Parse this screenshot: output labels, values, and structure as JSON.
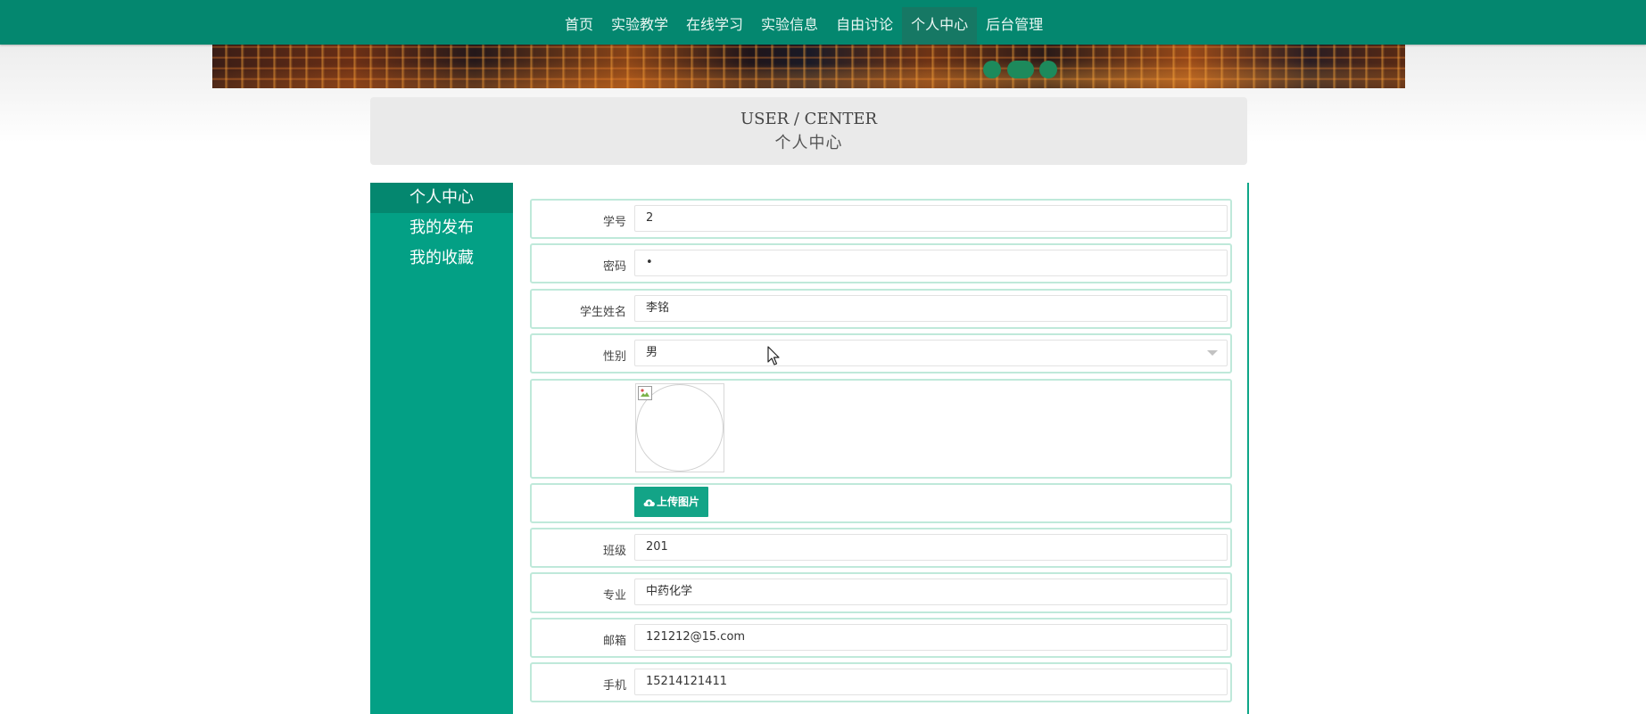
{
  "nav": {
    "items": [
      {
        "label": "首页",
        "active": false
      },
      {
        "label": "实验教学",
        "active": false
      },
      {
        "label": "在线学习",
        "active": false
      },
      {
        "label": "实验信息",
        "active": false
      },
      {
        "label": "自由讨论",
        "active": false
      },
      {
        "label": "个人中心",
        "active": true
      },
      {
        "label": "后台管理",
        "active": false
      }
    ]
  },
  "header": {
    "en_title": "USER / CENTER",
    "cn_title": "个人中心"
  },
  "sidebar": {
    "items": [
      {
        "label": "个人中心",
        "active": true
      },
      {
        "label": "我的发布",
        "active": false
      },
      {
        "label": "我的收藏",
        "active": false
      }
    ]
  },
  "form": {
    "student_id": {
      "label": "学号",
      "value": "2"
    },
    "password": {
      "label": "密码",
      "value": "•"
    },
    "student_name": {
      "label": "学生姓名",
      "value": "李铭"
    },
    "gender": {
      "label": "性别",
      "value": "男"
    },
    "upload_label": "上传图片",
    "class": {
      "label": "班级",
      "value": "201"
    },
    "major": {
      "label": "专业",
      "value": "中药化学"
    },
    "email": {
      "label": "邮箱",
      "value": "121212@15.com"
    },
    "phone": {
      "label": "手机",
      "value": "15214121411"
    }
  },
  "colors": {
    "nav_bg": "#04876f",
    "sidebar_bg": "#03a085",
    "accent": "#13a487",
    "row_border": "#bfe9da"
  },
  "icons": {
    "upload": "cloud-upload-icon",
    "select": "chevron-down-icon",
    "cursor": "mouse-pointer-icon"
  }
}
